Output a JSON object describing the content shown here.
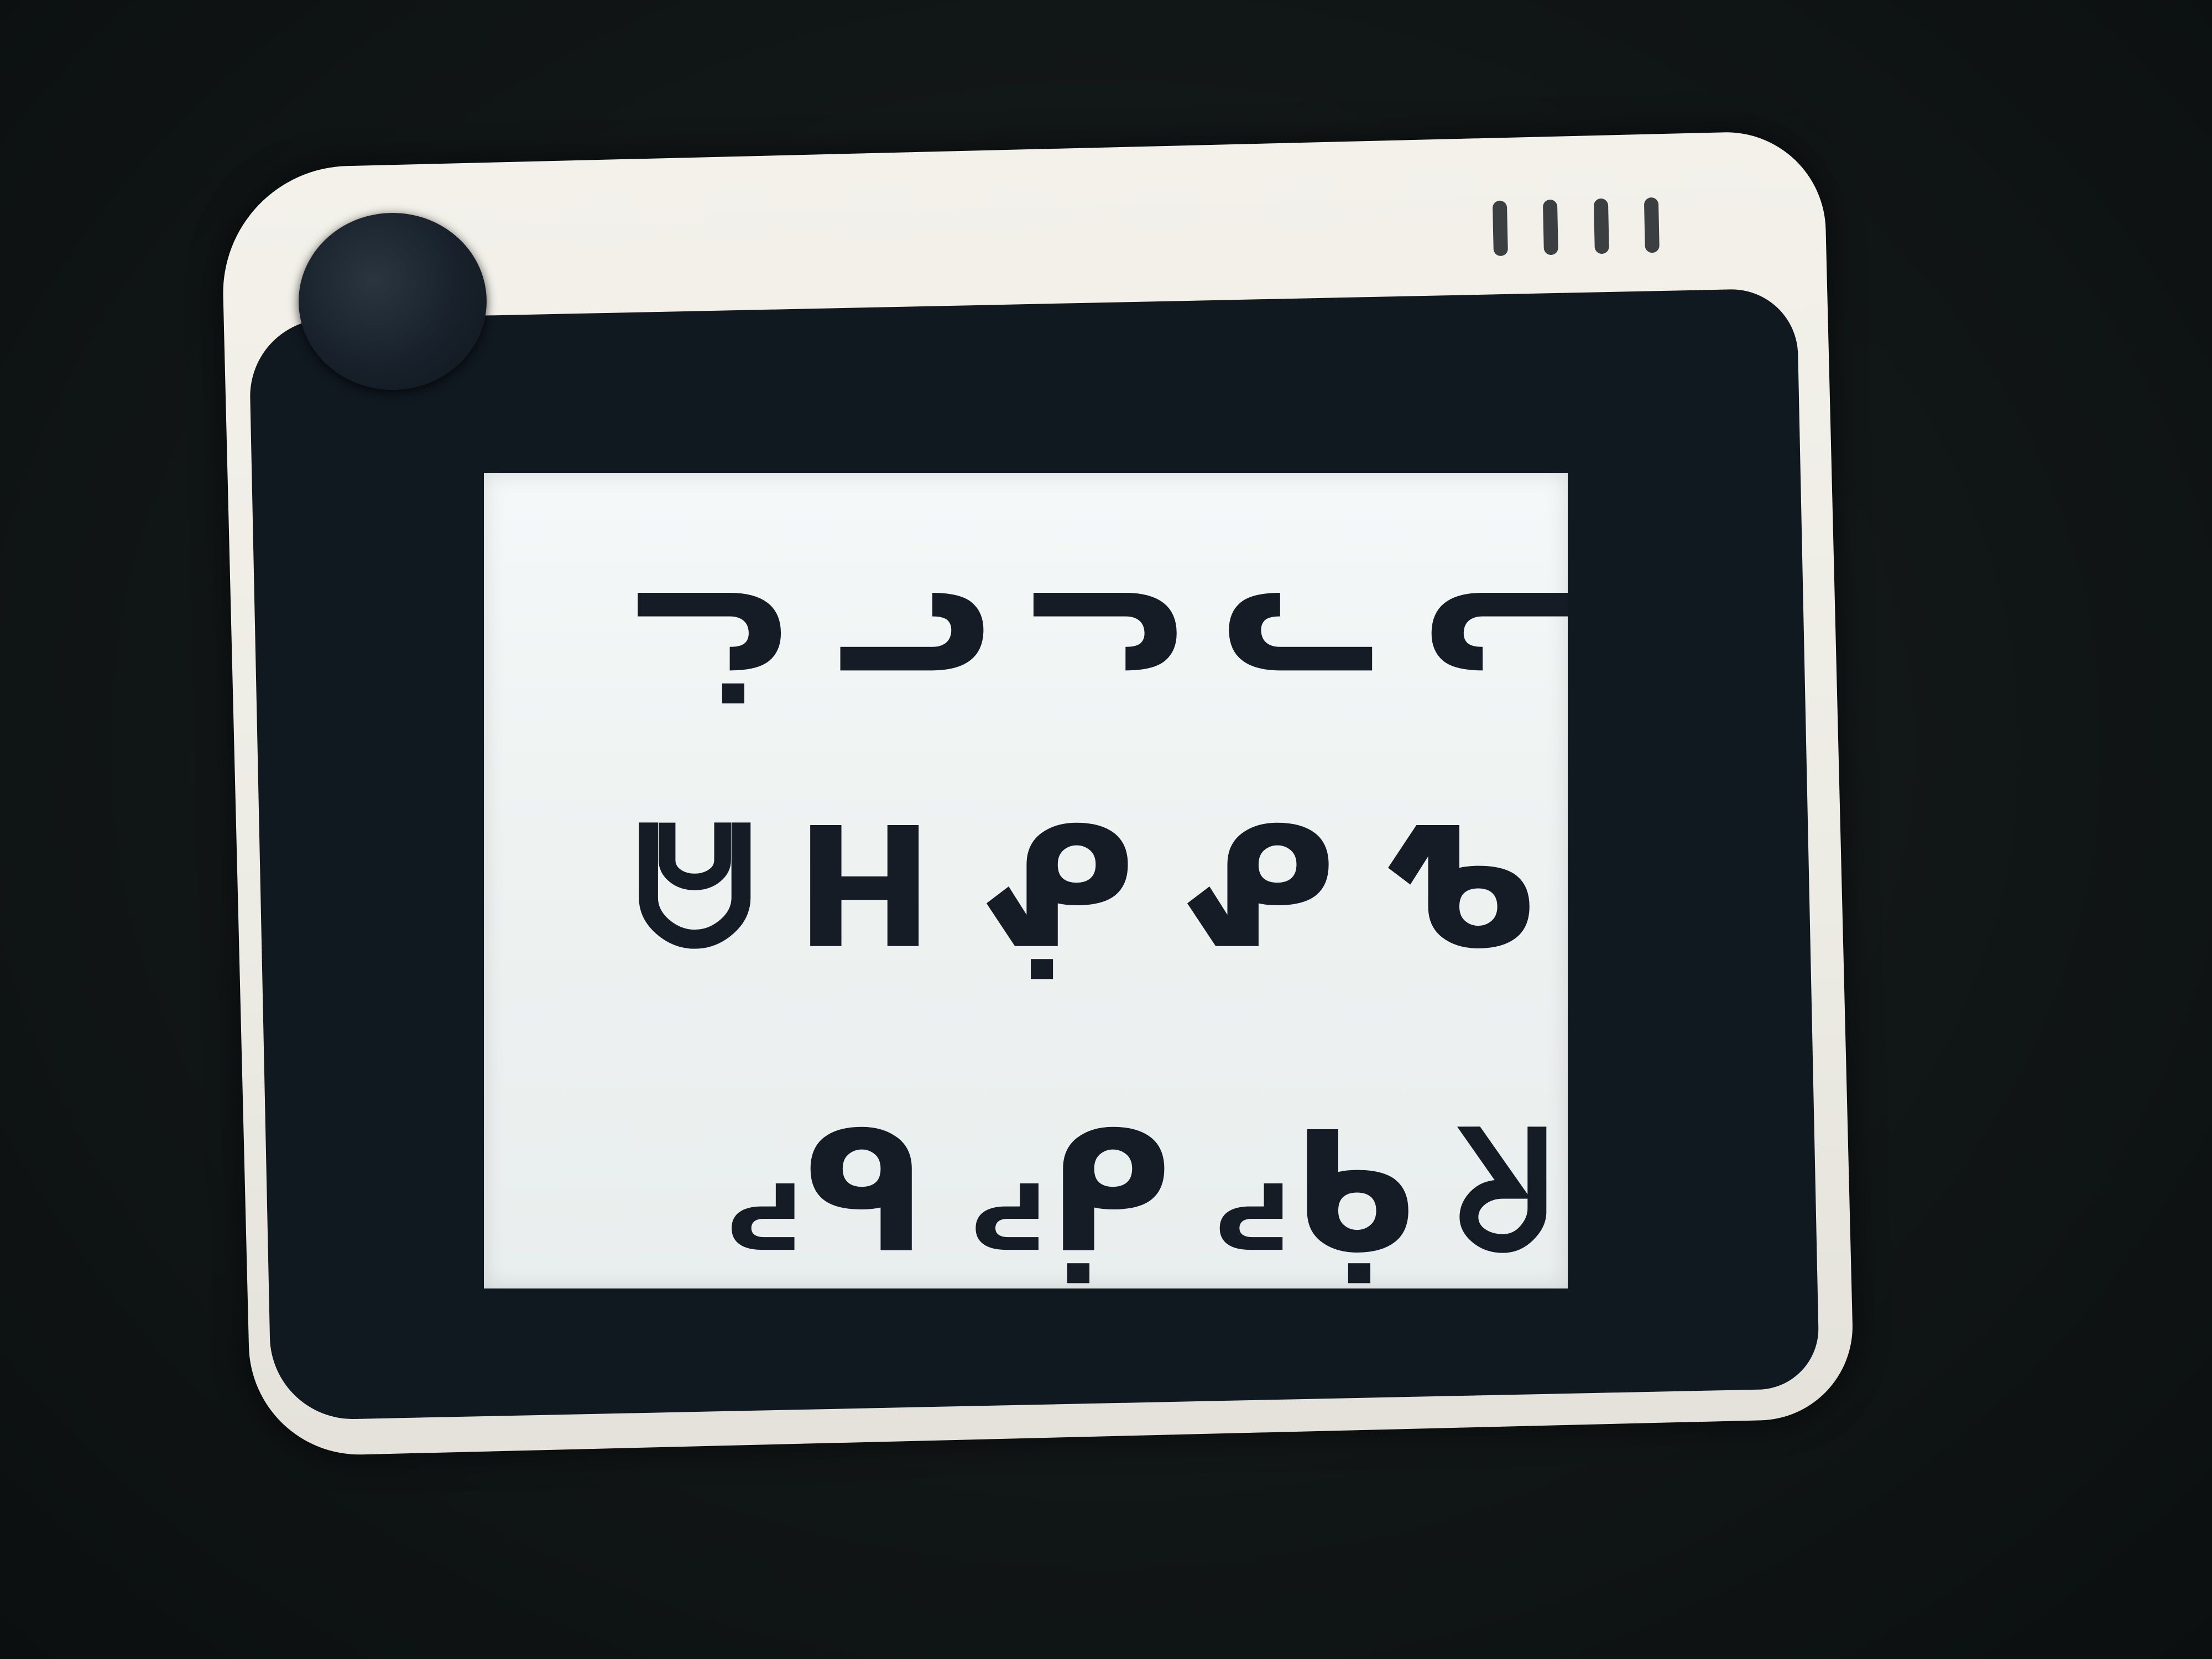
{
  "screen": {
    "rows": [
      "ᓘᓓᓗᓕᓚᓔ",
      "ᕱᕼᕺᕹᕵᕻ",
      "ᖁᖄᖀᖆᖂ"
    ]
  }
}
